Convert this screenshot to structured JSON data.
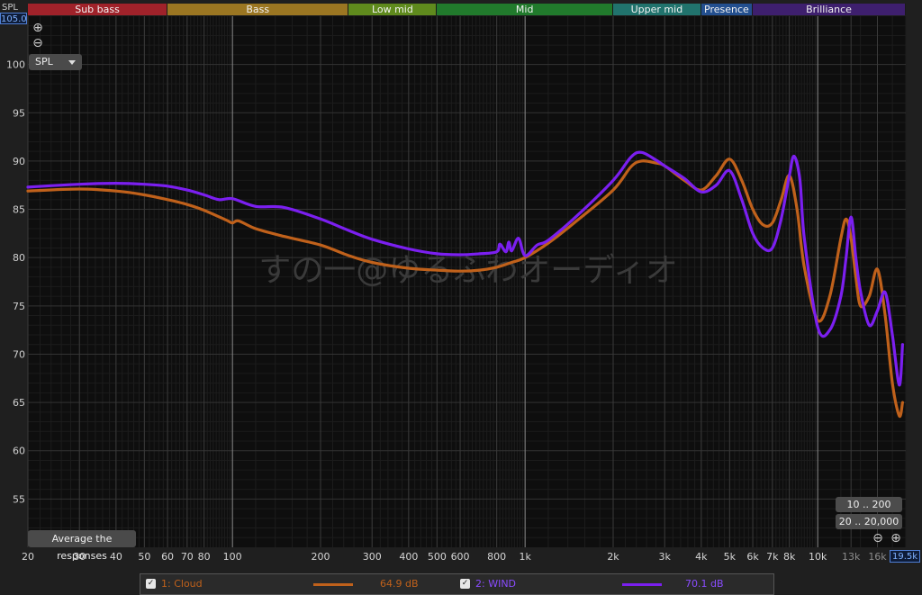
{
  "header": {
    "axis_unit_label": "SPL",
    "top_value": "105.00"
  },
  "bands": [
    {
      "label": "Sub bass",
      "from": 20,
      "to": 60,
      "color": "#a0222a"
    },
    {
      "label": "Bass",
      "from": 60,
      "to": 250,
      "color": "#9b7622"
    },
    {
      "label": "Low mid",
      "from": 250,
      "to": 500,
      "color": "#5f8a1d"
    },
    {
      "label": "Mid",
      "from": 500,
      "to": 2000,
      "color": "#217a2c"
    },
    {
      "label": "Upper mid",
      "from": 2000,
      "to": 4000,
      "color": "#21736d"
    },
    {
      "label": "Presence",
      "from": 4000,
      "to": 6000,
      "color": "#234f8f"
    },
    {
      "label": "Brilliance",
      "from": 6000,
      "to": 20000,
      "color": "#3e1f6e"
    }
  ],
  "controls": {
    "zoom_in": "⊕",
    "zoom_out": "⊖",
    "spl_dropdown": "SPL",
    "average_button": "Average the responses",
    "range_button_1": "10 .. 200",
    "range_button_2": "20 .. 20,000",
    "x_top_readout": "19.5k"
  },
  "watermark": "すの一@ゆるふわオーディオ",
  "colors": {
    "cloud": "#c0611b",
    "wind": "#7b1ff0",
    "background": "#0e0e0e",
    "grid": "#2f2f2f"
  },
  "chart_data": {
    "type": "line",
    "x_scale": "log",
    "xlim": [
      20,
      20000
    ],
    "ylim": [
      50,
      105
    ],
    "x_ticks": [
      {
        "value": 20,
        "label": "20"
      },
      {
        "value": 30,
        "label": "30"
      },
      {
        "value": 40,
        "label": "40"
      },
      {
        "value": 50,
        "label": "50"
      },
      {
        "value": 60,
        "label": "60"
      },
      {
        "value": 70,
        "label": "70"
      },
      {
        "value": 80,
        "label": "80"
      },
      {
        "value": 100,
        "label": "100"
      },
      {
        "value": 200,
        "label": "200"
      },
      {
        "value": 300,
        "label": "300"
      },
      {
        "value": 400,
        "label": "400"
      },
      {
        "value": 500,
        "label": "500"
      },
      {
        "value": 600,
        "label": "600"
      },
      {
        "value": 800,
        "label": "800"
      },
      {
        "value": 1000,
        "label": "1k"
      },
      {
        "value": 2000,
        "label": "2k"
      },
      {
        "value": 3000,
        "label": "3k"
      },
      {
        "value": 4000,
        "label": "4k"
      },
      {
        "value": 5000,
        "label": "5k"
      },
      {
        "value": 6000,
        "label": "6k"
      },
      {
        "value": 7000,
        "label": "7k"
      },
      {
        "value": 8000,
        "label": "8k"
      },
      {
        "value": 10000,
        "label": "10k"
      },
      {
        "value": 13000,
        "label": "13k"
      },
      {
        "value": 16000,
        "label": "16k"
      }
    ],
    "y_ticks": [
      55,
      60,
      65,
      70,
      75,
      80,
      85,
      90,
      95,
      100
    ],
    "grid": true,
    "series": [
      {
        "name": "1: Cloud",
        "legend_value": "64.9 dB",
        "color": "#c0611b",
        "x": [
          20,
          30,
          40,
          50,
          60,
          70,
          80,
          95,
          100,
          105,
          120,
          150,
          200,
          250,
          300,
          400,
          500,
          600,
          700,
          800,
          900,
          1000,
          1200,
          1500,
          2000,
          2300,
          2500,
          2800,
          3000,
          3500,
          4000,
          4500,
          5000,
          5500,
          6000,
          6500,
          7000,
          7500,
          8000,
          8500,
          9000,
          10000,
          11000,
          12000,
          12500,
          13000,
          13500,
          14000,
          15000,
          16000,
          17000,
          18000,
          19000,
          19500
        ],
        "y": [
          86.9,
          87.1,
          86.9,
          86.5,
          86.0,
          85.5,
          84.9,
          83.9,
          83.6,
          83.8,
          83.0,
          82.2,
          81.3,
          80.2,
          79.5,
          78.9,
          78.7,
          78.6,
          78.7,
          79.0,
          79.5,
          80.0,
          81.5,
          83.8,
          87.0,
          89.4,
          90.0,
          89.8,
          89.5,
          88.0,
          87.0,
          88.5,
          90.2,
          88.0,
          85.0,
          83.4,
          83.6,
          86.0,
          88.5,
          85.0,
          79.0,
          73.5,
          76.0,
          82.0,
          84.0,
          82.0,
          78.0,
          75.0,
          76.0,
          78.8,
          74.0,
          67.0,
          63.6,
          65.0
        ]
      },
      {
        "name": "2: WIND",
        "legend_value": "70.1 dB",
        "color": "#7b1ff0",
        "x": [
          20,
          30,
          40,
          50,
          60,
          70,
          80,
          90,
          100,
          120,
          150,
          200,
          250,
          300,
          400,
          500,
          600,
          700,
          800,
          820,
          860,
          880,
          900,
          950,
          1000,
          1100,
          1200,
          1500,
          2000,
          2300,
          2500,
          2800,
          3000,
          3500,
          4000,
          4500,
          5000,
          5500,
          6000,
          6500,
          7000,
          7500,
          8000,
          8300,
          8700,
          9000,
          10000,
          11000,
          12000,
          12500,
          13000,
          13500,
          14000,
          15000,
          16000,
          17000,
          18000,
          19000,
          19500
        ],
        "y": [
          87.3,
          87.6,
          87.7,
          87.6,
          87.4,
          87.0,
          86.5,
          86.0,
          86.1,
          85.3,
          85.2,
          84.0,
          82.8,
          81.9,
          80.9,
          80.4,
          80.3,
          80.4,
          80.6,
          81.4,
          80.6,
          81.6,
          80.7,
          82.0,
          80.2,
          81.3,
          81.8,
          84.3,
          88.0,
          90.4,
          90.9,
          90.1,
          89.5,
          88.2,
          86.8,
          87.5,
          89.0,
          86.0,
          82.5,
          81.0,
          81.0,
          84.0,
          88.5,
          90.5,
          88.0,
          82.0,
          72.8,
          72.5,
          76.0,
          80.0,
          84.2,
          80.0,
          76.5,
          73.0,
          74.5,
          76.4,
          72.0,
          66.8,
          71.0
        ]
      }
    ]
  }
}
